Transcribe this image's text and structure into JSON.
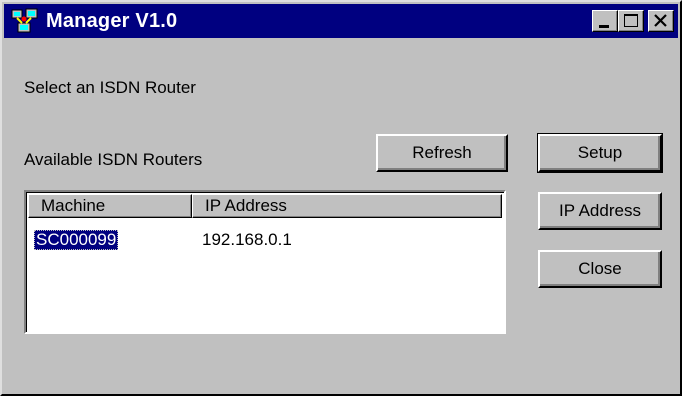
{
  "window": {
    "title": "Manager V1.0"
  },
  "title_buttons": {
    "minimize": "minimize-icon",
    "maximize": "maximize-icon",
    "close": "close-icon"
  },
  "labels": {
    "prompt": "Select an ISDN Router",
    "available": "Available ISDN Routers"
  },
  "buttons": {
    "refresh": "Refresh",
    "setup": "Setup",
    "ip_address": "IP Address",
    "close": "Close"
  },
  "router_list": {
    "columns": [
      "Machine",
      "IP Address"
    ],
    "rows": [
      {
        "machine": "SC000099",
        "ip": "192.168.0.1",
        "selected": true
      }
    ]
  },
  "colors": {
    "titlebar": "#000080",
    "face": "#c0c0c0",
    "selection": "#000080"
  }
}
